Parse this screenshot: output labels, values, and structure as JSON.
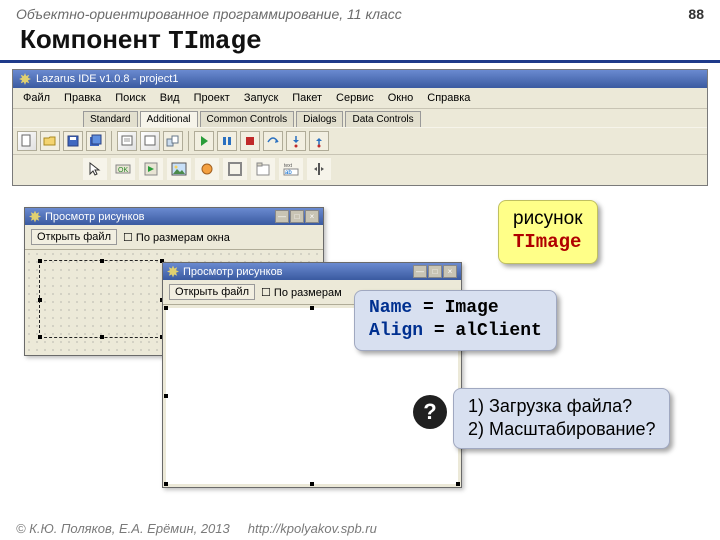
{
  "header": {
    "course": "Объектно-ориентированное программирование, 11 класс",
    "page": "88"
  },
  "title": {
    "prefix": "Компонент ",
    "component": "TImage"
  },
  "ide": {
    "title": "Lazarus IDE v1.0.8 - project1",
    "menu": [
      "Файл",
      "Правка",
      "Поиск",
      "Вид",
      "Проект",
      "Запуск",
      "Пакет",
      "Сервис",
      "Окно",
      "Справка"
    ],
    "tabs": [
      "Standard",
      "Additional",
      "Common Controls",
      "Dialogs",
      "Data Controls"
    ],
    "active_tab": 1,
    "text_label_icon": "text"
  },
  "win1": {
    "title": "Просмотр рисунков",
    "open_btn": "Открыть файл",
    "checkbox": "По размерам окна"
  },
  "win2": {
    "title": "Просмотр рисунков",
    "open_btn": "Открыть файл",
    "checkbox": "По размерам"
  },
  "callout1": {
    "line1": "рисунок",
    "line2": "TImage"
  },
  "callout2": {
    "k1": "Name",
    "eq": " = ",
    "v1": "Image",
    "k2": "Align",
    "v2": "alClient"
  },
  "question": {
    "badge": "?",
    "q1": "1) Загрузка файла?",
    "q2": "2) Масштабирование?"
  },
  "footer": {
    "copyright": "© К.Ю. Поляков, Е.А. Ерёмин, 2013",
    "url": "http://kpolyakov.spb.ru"
  }
}
